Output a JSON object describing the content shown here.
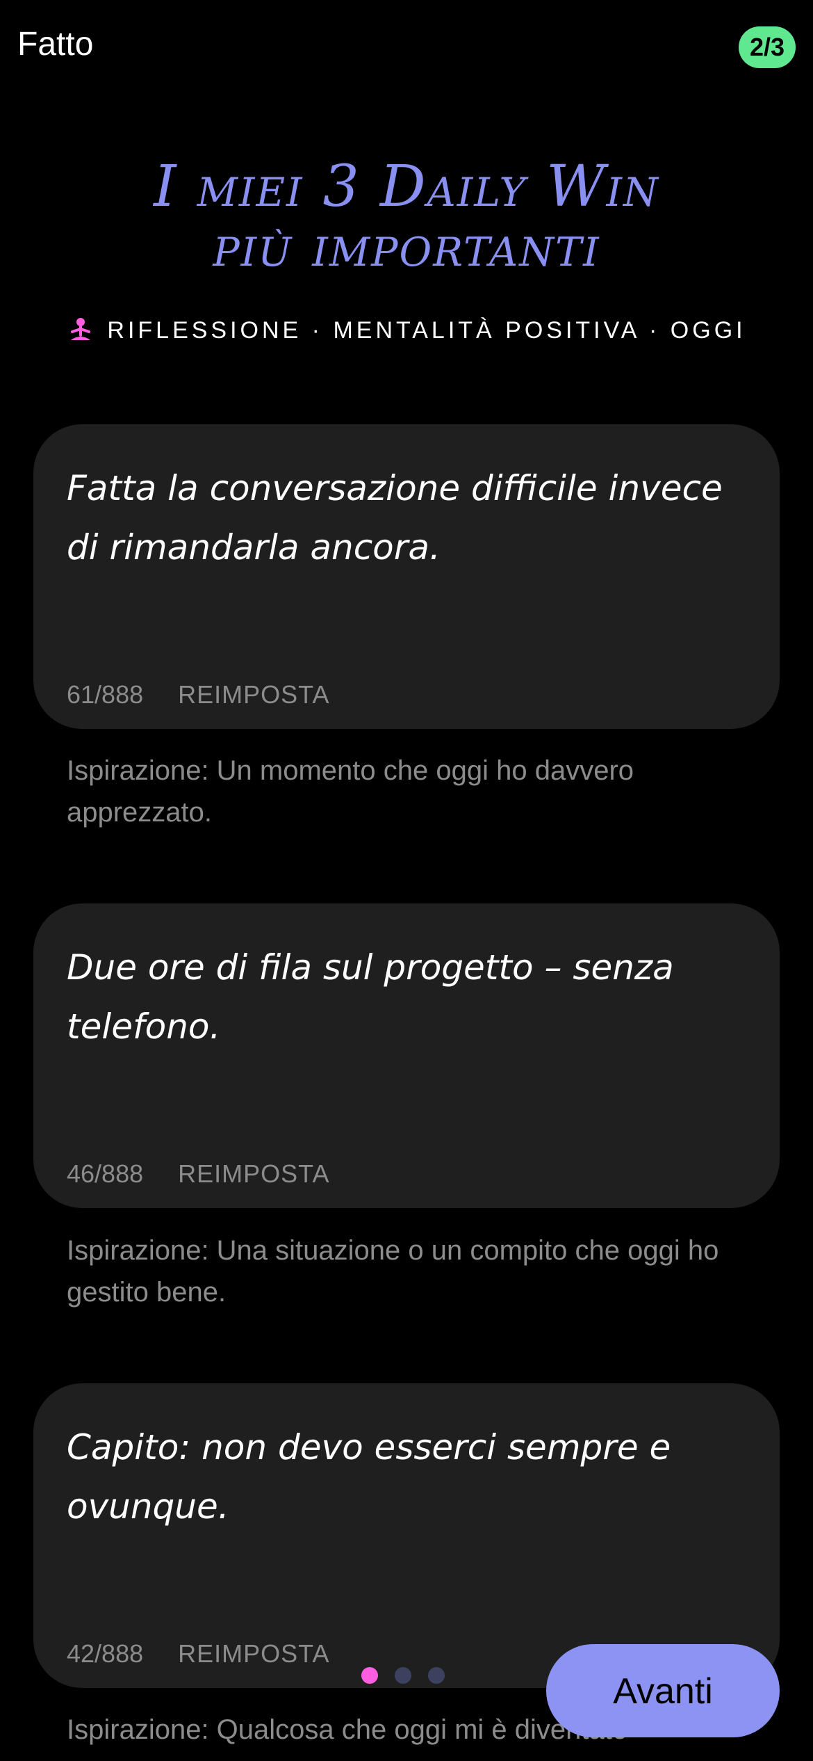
{
  "header": {
    "done_label": "Fatto",
    "step_badge": "2/3",
    "step_badge_color": "#5fe88f"
  },
  "title": {
    "line1": "I miei 3 Daily Win",
    "line2": "più importanti",
    "color": "#8a90f2"
  },
  "subtitle": {
    "icon": "meditation-icon",
    "text": "RIFLESSIONE · MENTALITÀ POSITIVA · OGGI"
  },
  "entries": [
    {
      "text": "Fatta la conversazione difficile invece di rimandarla ancora.",
      "counter": "61/888",
      "reset_label": "REIMPOSTA",
      "inspiration": "Ispirazione: Un momento che oggi ho davvero apprezzato."
    },
    {
      "text": "Due ore di fila sul progetto – senza telefono.",
      "counter": "46/888",
      "reset_label": "REIMPOSTA",
      "inspiration": "Ispirazione: Una situazione o un compito che oggi ho gestito bene."
    },
    {
      "text": "Capito: non devo esserci sempre e ovunque.",
      "counter": "42/888",
      "reset_label": "REIMPOSTA",
      "inspiration": "Ispirazione: Qualcosa che oggi mi è diventato"
    }
  ],
  "pager": {
    "active_index": 0,
    "count": 3,
    "active_color": "#ff5ee0"
  },
  "footer": {
    "next_label": "Avanti",
    "next_color": "#8c93f2"
  }
}
